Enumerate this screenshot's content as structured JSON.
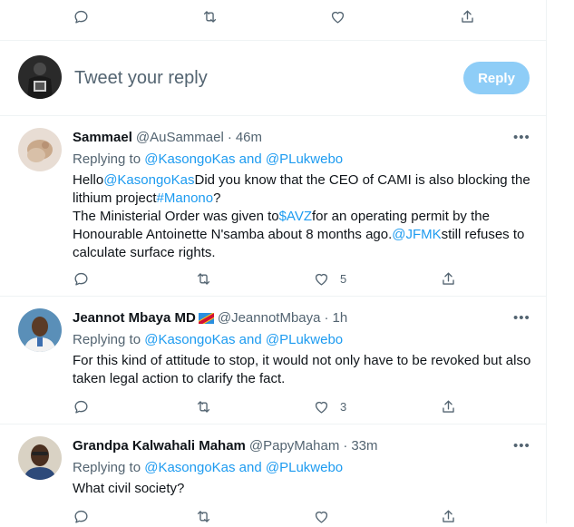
{
  "composer": {
    "placeholder": "Tweet your reply",
    "reply_label": "Reply"
  },
  "top_actions": {
    "reply": "",
    "retweet": "",
    "like": "",
    "share": ""
  },
  "tweets": [
    {
      "name": "Sammael",
      "handle": "@AuSammael",
      "time": "46m",
      "replying_prefix": "Replying to ",
      "replying_to": "@KasongoKas and @PLukwebo",
      "body": [
        {
          "t": "Hello",
          "link": false
        },
        {
          "t": "@KasongoKas",
          "link": true
        },
        {
          "t": "Did you know that the CEO of CAMI is also blocking the lithium project",
          "link": false
        },
        {
          "t": "#Manono",
          "link": true
        },
        {
          "t": "?",
          "link": false
        },
        {
          "t": "\n",
          "link": false
        },
        {
          "t": "The Ministerial Order was given to",
          "link": false
        },
        {
          "t": "$AVZ",
          "link": true
        },
        {
          "t": "for an operating permit by the Honourable Antoinette N'samba about 8 months ago.",
          "link": false
        },
        {
          "t": "@JFMK",
          "link": true
        },
        {
          "t": "still refuses to calculate surface rights.",
          "link": false
        }
      ],
      "likes": "5",
      "retweets": ""
    },
    {
      "name": "Jeannot Mbaya MD",
      "has_flag": true,
      "handle": "@JeannotMbaya",
      "time": "1h",
      "replying_prefix": "Replying to ",
      "replying_to": "@KasongoKas and @PLukwebo",
      "body": [
        {
          "t": "For this kind of attitude to stop, it would not only have to be revoked but also taken legal action to clarify the fact.",
          "link": false
        }
      ],
      "likes": "3",
      "retweets": ""
    },
    {
      "name": "Grandpa Kalwahali Maham",
      "handle": "@PapyMaham",
      "time": "33m",
      "replying_prefix": "Replying to ",
      "replying_to": "@KasongoKas and @PLukwebo",
      "body": [
        {
          "t": "What civil society?",
          "link": false
        }
      ],
      "likes": "",
      "retweets": ""
    }
  ],
  "colors": {
    "accent": "#1d9bf0",
    "muted": "#536471",
    "reply_disabled": "#8ecdf7"
  }
}
